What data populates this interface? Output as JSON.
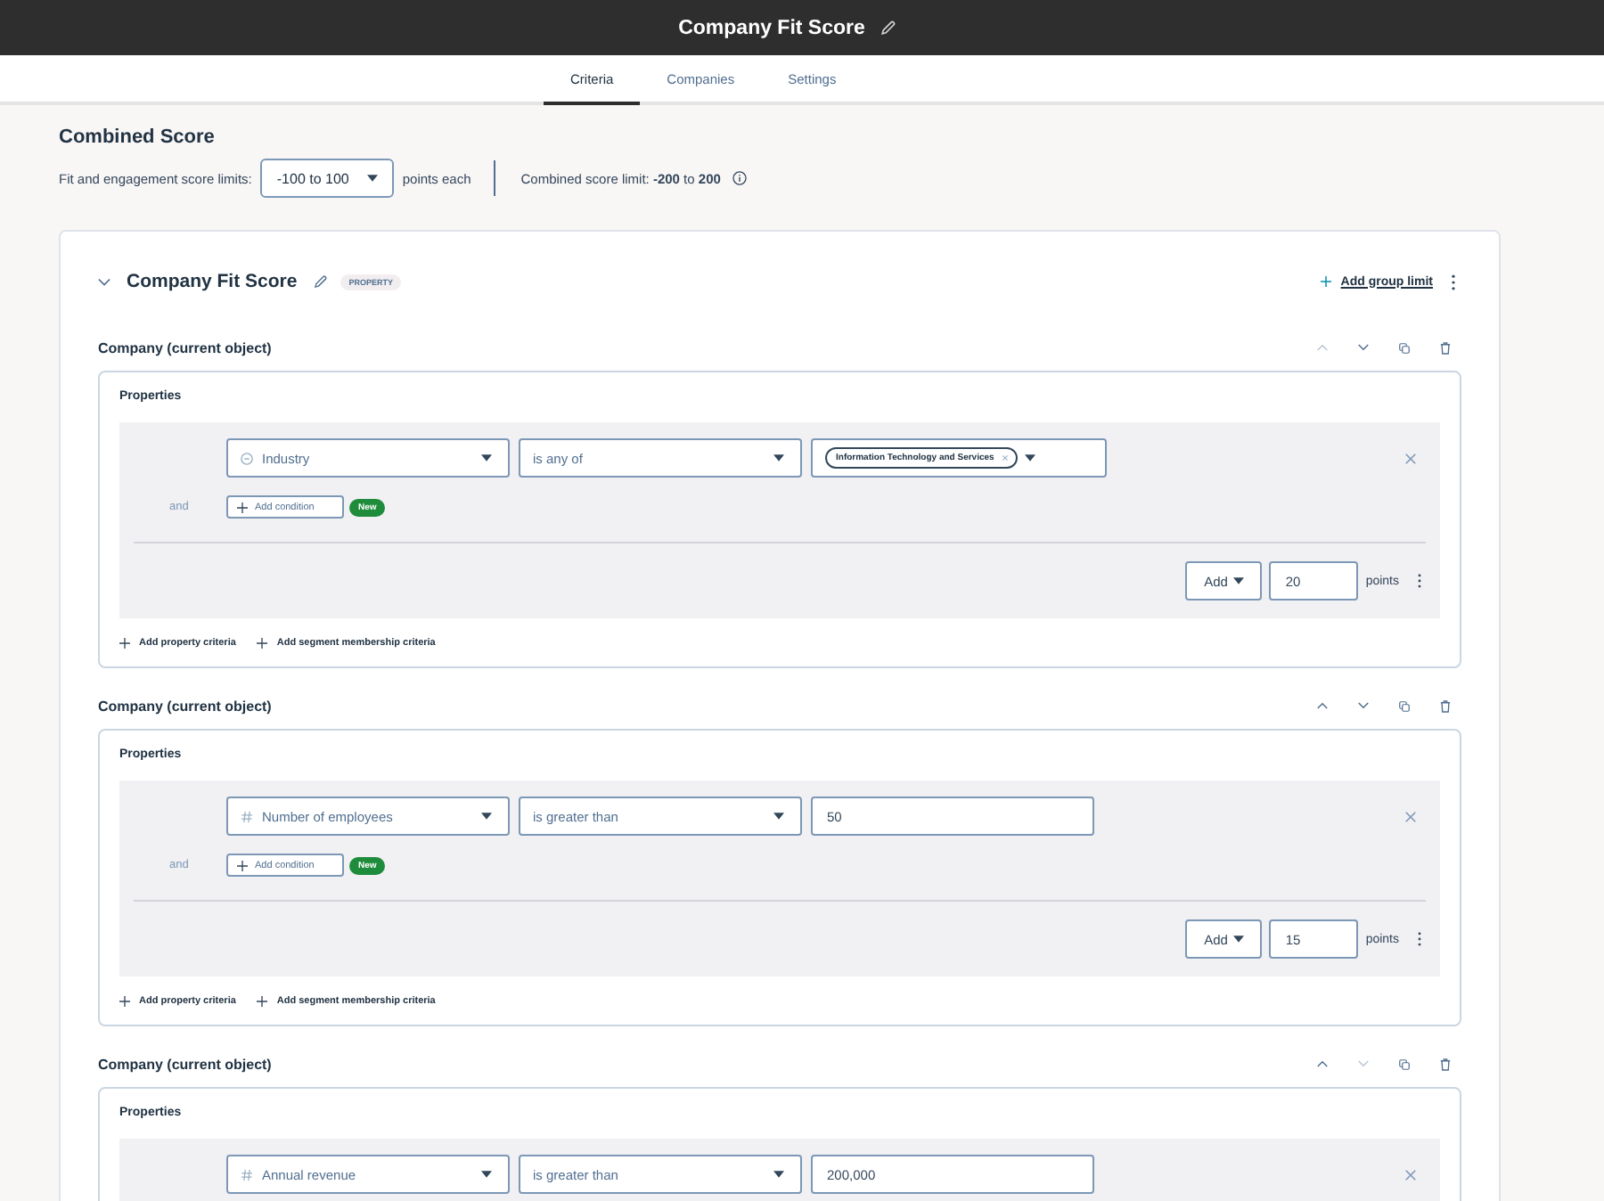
{
  "header": {
    "title": "Company Fit Score"
  },
  "tabs": [
    {
      "label": "Criteria",
      "selected": true
    },
    {
      "label": "Companies",
      "selected": false
    },
    {
      "label": "Settings",
      "selected": false
    }
  ],
  "combined_score": {
    "title": "Combined Score",
    "limits_label": "Fit and engagement score limits:",
    "limits_select": "-100 to 100",
    "limits_suffix": "points each",
    "combined_limit": "Combined score limit: **-200** to **200**"
  },
  "score_card": {
    "title": "Company Fit Score",
    "badge": "PROPERTY",
    "expanded": true,
    "add_group_limit": "Add group limit",
    "groups": [
      {
        "label": "Company (current object)",
        "move_up_disabled": true,
        "move_down_disabled": false,
        "section_title": "Properties",
        "conditions": [
          {
            "kind": "multi-select",
            "property": {
              "kind": "enumeration",
              "label": "Industry"
            },
            "operator": "is any of",
            "values": [
              "Information Technology and Services"
            ]
          }
        ],
        "and_label": "and",
        "add_condition": "Add condition",
        "new_badge": "New",
        "score": {
          "action": "Add",
          "points": "20",
          "unit": "points"
        },
        "links": [
          "Add property criteria",
          "Add segment membership criteria"
        ]
      },
      {
        "label": "Company (current object)",
        "move_up_disabled": false,
        "move_down_disabled": false,
        "section_title": "Properties",
        "conditions": [
          {
            "kind": "text-input",
            "property": {
              "kind": "number",
              "label": "Number of employees"
            },
            "operator": "is greater than",
            "value": "50"
          }
        ],
        "and_label": "and",
        "add_condition": "Add condition",
        "new_badge": "New",
        "score": {
          "action": "Add",
          "points": "15",
          "unit": "points"
        },
        "links": [
          "Add property criteria",
          "Add segment membership criteria"
        ]
      },
      {
        "label": "Company (current object)",
        "move_up_disabled": false,
        "move_down_disabled": true,
        "section_title": "Properties",
        "conditions": [
          {
            "kind": "text-input",
            "property": {
              "kind": "number",
              "label": "Annual revenue"
            },
            "operator": "is greater than",
            "value": "200,000"
          }
        ]
      }
    ]
  }
}
